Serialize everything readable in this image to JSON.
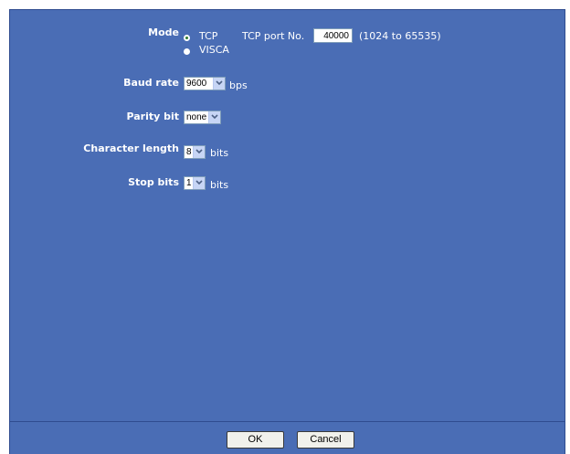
{
  "form": {
    "mode": {
      "label": "Mode",
      "options": [
        "TCP",
        "VISCA"
      ],
      "selected": "TCP",
      "tcp_port_label": "TCP port No.",
      "tcp_port_value": "40000",
      "tcp_port_range": "(1024 to 65535)"
    },
    "baud_rate": {
      "label": "Baud rate",
      "value": "9600",
      "unit": "bps"
    },
    "parity_bit": {
      "label": "Parity bit",
      "value": "none"
    },
    "character_length": {
      "label": "Character length",
      "value": "8",
      "unit": "bits"
    },
    "stop_bits": {
      "label": "Stop bits",
      "value": "1",
      "unit": "bits"
    }
  },
  "buttons": {
    "ok": "OK",
    "cancel": "Cancel"
  },
  "colors": {
    "panel": "#4a6db5",
    "text": "#ffffff"
  }
}
